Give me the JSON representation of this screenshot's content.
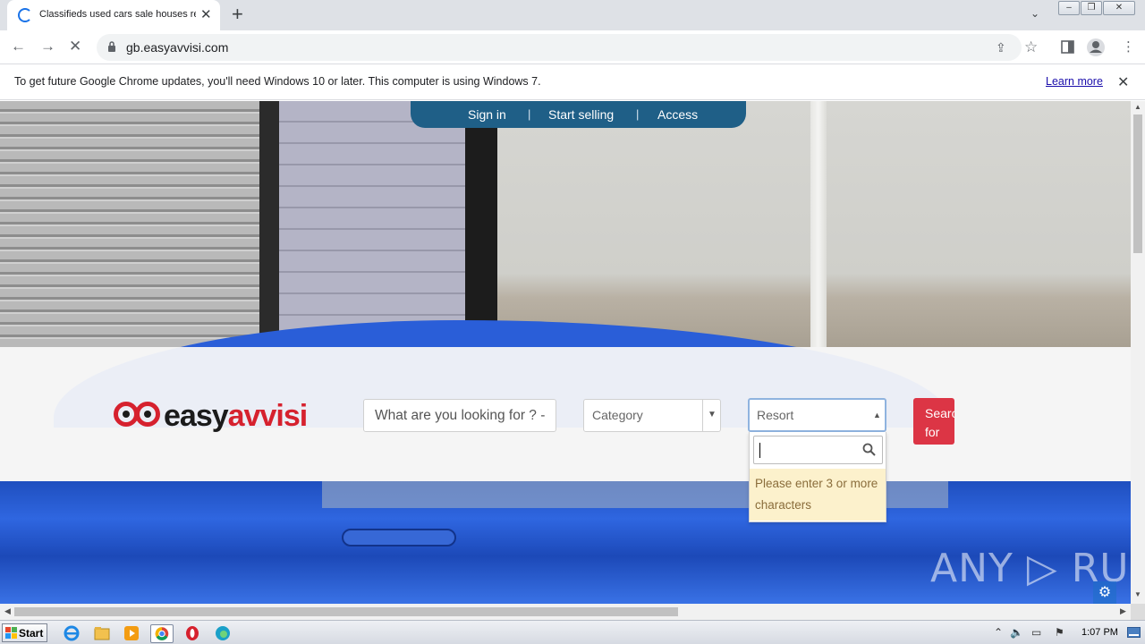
{
  "browser": {
    "tab_title": "Classifieds used cars sale houses rent",
    "url": "gb.easyavvisi.com",
    "new_tab_label": "+",
    "infobar_message": "To get future Google Chrome updates, you'll need Windows 10 or later. This computer is using Windows 7.",
    "infobar_link": "Learn more"
  },
  "page": {
    "top_nav": [
      "Sign in",
      "Start selling",
      "Access"
    ],
    "top_nav_separator": "|",
    "logo_part1": "easy",
    "logo_part2": "avvisi",
    "search_placeholder": "What are you looking for ? -",
    "category_select": "Category",
    "resort_select": "Resort",
    "dropdown_message": "Please enter 3 or more characters",
    "search_button_line1": "Search",
    "search_button_line2": "for",
    "brand_colors": {
      "primary_red": "#d6212e",
      "nav_blue": "#1f5f87",
      "button_red": "#dc3545"
    }
  },
  "watermark": "ANY ▷ RUN",
  "taskbar": {
    "start_label": "Start",
    "clock": "1:07 PM"
  },
  "icons": {
    "tab_close": "✕",
    "back": "←",
    "forward": "→",
    "stop": "✕",
    "share": "⇪",
    "star": "☆",
    "menu": "⋮",
    "infobar_close": "✕",
    "chevron": "⌄",
    "gear": "⚙",
    "select_arrow_down": "▼",
    "select_arrow_up": "▲",
    "scroll_up": "▲",
    "scroll_down": "▼",
    "scroll_left": "◀",
    "scroll_right": "▶",
    "tray_up": "⌃",
    "speaker": "🔈",
    "network": "▭",
    "flag": "⚑",
    "min": "–",
    "max": "❐",
    "close": "✕"
  }
}
